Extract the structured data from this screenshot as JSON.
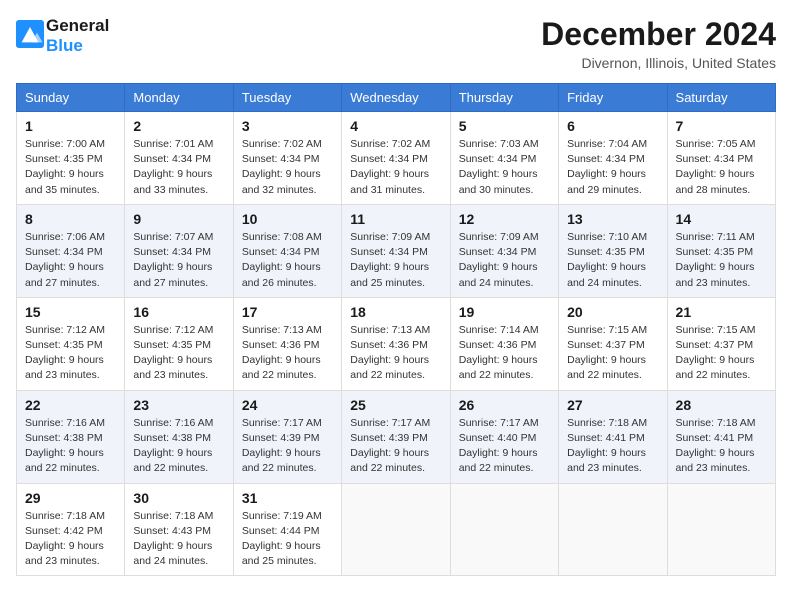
{
  "header": {
    "logo_line1": "General",
    "logo_line2": "Blue",
    "month_title": "December 2024",
    "location": "Divernon, Illinois, United States"
  },
  "calendar": {
    "weekdays": [
      "Sunday",
      "Monday",
      "Tuesday",
      "Wednesday",
      "Thursday",
      "Friday",
      "Saturday"
    ],
    "weeks": [
      [
        {
          "day": "",
          "empty": true
        },
        {
          "day": "",
          "empty": true
        },
        {
          "day": "",
          "empty": true
        },
        {
          "day": "",
          "empty": true
        },
        {
          "day": "5",
          "sunrise": "7:03 AM",
          "sunset": "4:34 PM",
          "daylight": "9 hours and 30 minutes."
        },
        {
          "day": "6",
          "sunrise": "7:04 AM",
          "sunset": "4:34 PM",
          "daylight": "9 hours and 29 minutes."
        },
        {
          "day": "7",
          "sunrise": "7:05 AM",
          "sunset": "4:34 PM",
          "daylight": "9 hours and 28 minutes."
        }
      ],
      [
        {
          "day": "1",
          "sunrise": "7:00 AM",
          "sunset": "4:35 PM",
          "daylight": "9 hours and 35 minutes."
        },
        {
          "day": "2",
          "sunrise": "7:01 AM",
          "sunset": "4:34 PM",
          "daylight": "9 hours and 33 minutes."
        },
        {
          "day": "3",
          "sunrise": "7:02 AM",
          "sunset": "4:34 PM",
          "daylight": "9 hours and 32 minutes."
        },
        {
          "day": "4",
          "sunrise": "7:02 AM",
          "sunset": "4:34 PM",
          "daylight": "9 hours and 31 minutes."
        },
        {
          "day": "5",
          "sunrise": "7:03 AM",
          "sunset": "4:34 PM",
          "daylight": "9 hours and 30 minutes."
        },
        {
          "day": "6",
          "sunrise": "7:04 AM",
          "sunset": "4:34 PM",
          "daylight": "9 hours and 29 minutes."
        },
        {
          "day": "7",
          "sunrise": "7:05 AM",
          "sunset": "4:34 PM",
          "daylight": "9 hours and 28 minutes."
        }
      ],
      [
        {
          "day": "8",
          "sunrise": "7:06 AM",
          "sunset": "4:34 PM",
          "daylight": "9 hours and 27 minutes."
        },
        {
          "day": "9",
          "sunrise": "7:07 AM",
          "sunset": "4:34 PM",
          "daylight": "9 hours and 27 minutes."
        },
        {
          "day": "10",
          "sunrise": "7:08 AM",
          "sunset": "4:34 PM",
          "daylight": "9 hours and 26 minutes."
        },
        {
          "day": "11",
          "sunrise": "7:09 AM",
          "sunset": "4:34 PM",
          "daylight": "9 hours and 25 minutes."
        },
        {
          "day": "12",
          "sunrise": "7:09 AM",
          "sunset": "4:34 PM",
          "daylight": "9 hours and 24 minutes."
        },
        {
          "day": "13",
          "sunrise": "7:10 AM",
          "sunset": "4:35 PM",
          "daylight": "9 hours and 24 minutes."
        },
        {
          "day": "14",
          "sunrise": "7:11 AM",
          "sunset": "4:35 PM",
          "daylight": "9 hours and 23 minutes."
        }
      ],
      [
        {
          "day": "15",
          "sunrise": "7:12 AM",
          "sunset": "4:35 PM",
          "daylight": "9 hours and 23 minutes."
        },
        {
          "day": "16",
          "sunrise": "7:12 AM",
          "sunset": "4:35 PM",
          "daylight": "9 hours and 23 minutes."
        },
        {
          "day": "17",
          "sunrise": "7:13 AM",
          "sunset": "4:36 PM",
          "daylight": "9 hours and 22 minutes."
        },
        {
          "day": "18",
          "sunrise": "7:13 AM",
          "sunset": "4:36 PM",
          "daylight": "9 hours and 22 minutes."
        },
        {
          "day": "19",
          "sunrise": "7:14 AM",
          "sunset": "4:36 PM",
          "daylight": "9 hours and 22 minutes."
        },
        {
          "day": "20",
          "sunrise": "7:15 AM",
          "sunset": "4:37 PM",
          "daylight": "9 hours and 22 minutes."
        },
        {
          "day": "21",
          "sunrise": "7:15 AM",
          "sunset": "4:37 PM",
          "daylight": "9 hours and 22 minutes."
        }
      ],
      [
        {
          "day": "22",
          "sunrise": "7:16 AM",
          "sunset": "4:38 PM",
          "daylight": "9 hours and 22 minutes."
        },
        {
          "day": "23",
          "sunrise": "7:16 AM",
          "sunset": "4:38 PM",
          "daylight": "9 hours and 22 minutes."
        },
        {
          "day": "24",
          "sunrise": "7:17 AM",
          "sunset": "4:39 PM",
          "daylight": "9 hours and 22 minutes."
        },
        {
          "day": "25",
          "sunrise": "7:17 AM",
          "sunset": "4:39 PM",
          "daylight": "9 hours and 22 minutes."
        },
        {
          "day": "26",
          "sunrise": "7:17 AM",
          "sunset": "4:40 PM",
          "daylight": "9 hours and 22 minutes."
        },
        {
          "day": "27",
          "sunrise": "7:18 AM",
          "sunset": "4:41 PM",
          "daylight": "9 hours and 23 minutes."
        },
        {
          "day": "28",
          "sunrise": "7:18 AM",
          "sunset": "4:41 PM",
          "daylight": "9 hours and 23 minutes."
        }
      ],
      [
        {
          "day": "29",
          "sunrise": "7:18 AM",
          "sunset": "4:42 PM",
          "daylight": "9 hours and 23 minutes."
        },
        {
          "day": "30",
          "sunrise": "7:18 AM",
          "sunset": "4:43 PM",
          "daylight": "9 hours and 24 minutes."
        },
        {
          "day": "31",
          "sunrise": "7:19 AM",
          "sunset": "4:44 PM",
          "daylight": "9 hours and 25 minutes."
        },
        {
          "day": "",
          "empty": true
        },
        {
          "day": "",
          "empty": true
        },
        {
          "day": "",
          "empty": true
        },
        {
          "day": "",
          "empty": true
        }
      ]
    ]
  }
}
